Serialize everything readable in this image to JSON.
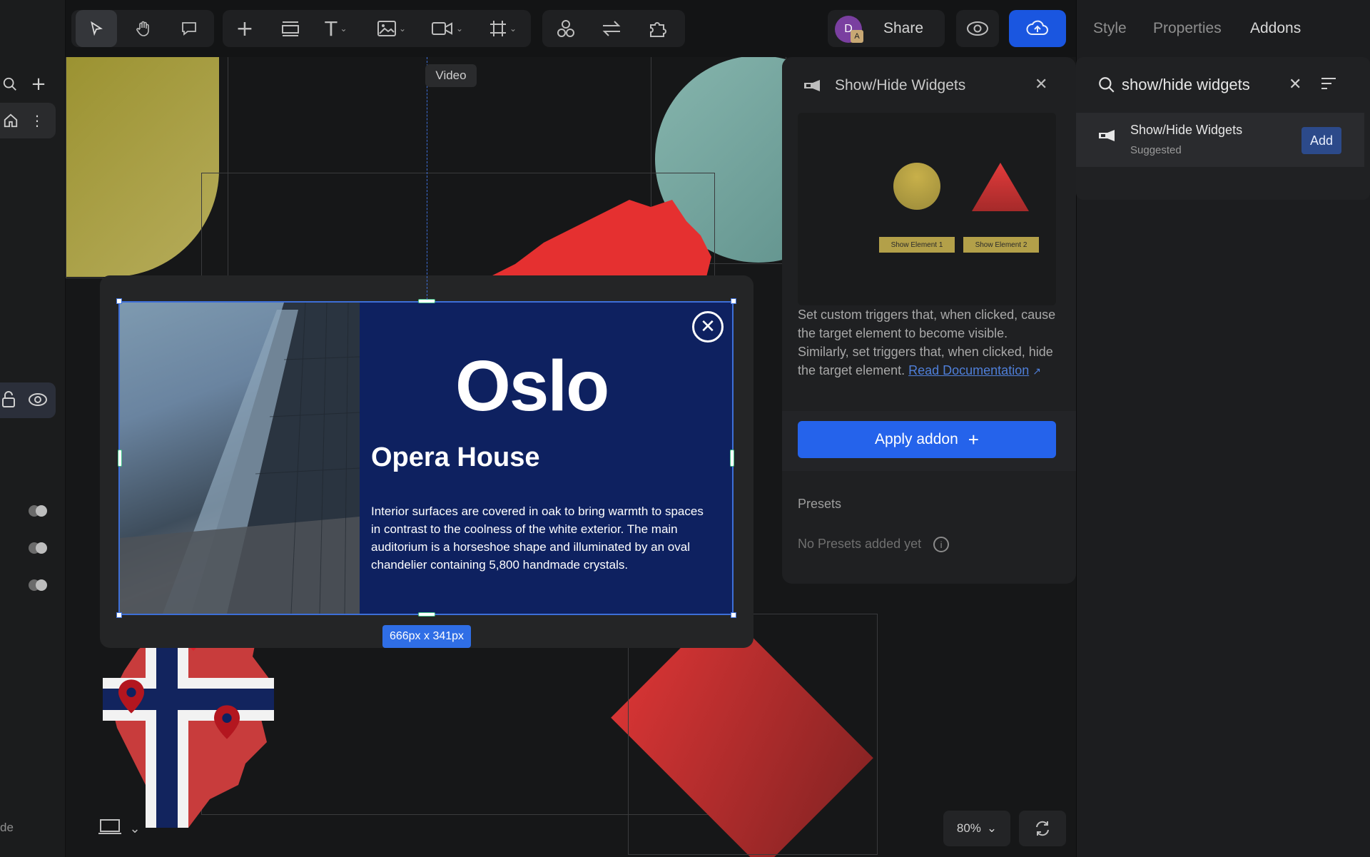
{
  "toolbar": {
    "share_label": "Share",
    "avatar_letter": "D",
    "avatar_badge": "A",
    "tooltip": "Video",
    "tools": [
      "select-tool",
      "hand-tool",
      "comment-tool",
      "add-tool",
      "container-tool",
      "text-tool",
      "image-tool",
      "video-tool",
      "frame-tool",
      "components-tool",
      "interactions-tool",
      "plugins-tool"
    ]
  },
  "tabs": [
    {
      "label": "Style",
      "active": false
    },
    {
      "label": "Properties",
      "active": false
    },
    {
      "label": "Addons",
      "active": true
    }
  ],
  "search": {
    "query": "show/hide widgets"
  },
  "result": {
    "title": "Show/Hide Widgets",
    "subtitle": "Suggested",
    "add_label": "Add"
  },
  "detail": {
    "title": "Show/Hide Widgets",
    "preview_button_1": "Show Element 1",
    "preview_button_2": "Show Element 2",
    "description": "Set custom triggers that, when clicked, cause the target element to become visible. Similarly, set triggers that, when clicked, hide the target element.",
    "read_link": "Read Documentation",
    "apply_label": "Apply addon",
    "presets_label": "Presets",
    "no_presets": "No Presets added yet"
  },
  "card": {
    "city": "Oslo",
    "heading": "Opera House",
    "body": "Interior surfaces are covered in oak to bring warmth to spaces in contrast to the coolness of the white exterior. The main auditorium is a horseshoe shape and illuminated by an oval chandelier containing 5,800 handmade crystals."
  },
  "selection": {
    "dimensions": "666px x 341px"
  },
  "footer": {
    "zoom": "80%",
    "left_label": "de"
  },
  "colors": {
    "accent": "#2563eb",
    "card_bg": "#0e2160",
    "selection": "#3d6fd8"
  }
}
